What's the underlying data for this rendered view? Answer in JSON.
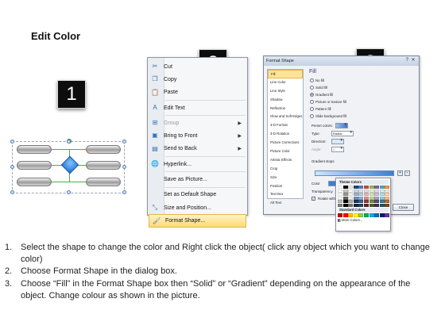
{
  "title": "Edit Color",
  "badges": [
    "1",
    "2",
    "3"
  ],
  "context_menu": {
    "items": [
      {
        "label": "Cut",
        "icon": "scissors-icon",
        "glyph": "✂",
        "disabled": false,
        "arrow": false
      },
      {
        "label": "Copy",
        "icon": "copy-icon",
        "glyph": "❐",
        "disabled": false,
        "arrow": false
      },
      {
        "label": "Paste",
        "icon": "paste-icon",
        "glyph": "📋",
        "disabled": false,
        "arrow": false
      },
      {
        "label": "Edit Text",
        "icon": "edit-text-icon",
        "glyph": "A",
        "disabled": false,
        "arrow": false,
        "sep_before": true
      },
      {
        "label": "Group",
        "icon": "group-icon",
        "glyph": "⊞",
        "disabled": true,
        "arrow": true,
        "sep_before": true
      },
      {
        "label": "Bring to Front",
        "icon": "bring-front-icon",
        "glyph": "▣",
        "disabled": false,
        "arrow": true
      },
      {
        "label": "Send to Back",
        "icon": "send-back-icon",
        "glyph": "▤",
        "disabled": false,
        "arrow": true
      },
      {
        "label": "Hyperlink...",
        "icon": "hyperlink-icon",
        "glyph": "🌐",
        "disabled": false,
        "arrow": false,
        "sep_before": true
      },
      {
        "label": "Save as Picture...",
        "icon": "",
        "glyph": "",
        "disabled": false,
        "arrow": false,
        "sep_before": true
      },
      {
        "label": "Set as Default Shape",
        "icon": "",
        "glyph": "",
        "disabled": false,
        "arrow": false,
        "sep_before": true
      },
      {
        "label": "Size and Position...",
        "icon": "size-position-icon",
        "glyph": "⤡",
        "disabled": false,
        "arrow": false
      },
      {
        "label": "Format Shape...",
        "icon": "format-shape-icon",
        "glyph": "🖌",
        "disabled": false,
        "arrow": false,
        "highlighted": true
      }
    ]
  },
  "dialog": {
    "title": "Format Shape",
    "help": "?",
    "close_glyph": "✕",
    "nav": [
      "Fill",
      "Line Color",
      "Line Style",
      "Shadow",
      "Reflection",
      "Glow and Soft Edges",
      "3-D Format",
      "3-D Rotation",
      "Picture Corrections",
      "Picture Color",
      "Artistic Effects",
      "Crop",
      "Size",
      "Position",
      "Text Box",
      "Alt Text"
    ],
    "selected_nav": "Fill",
    "heading": "Fill",
    "fill_options": [
      {
        "label": "No fill",
        "checked": false
      },
      {
        "label": "Solid fill",
        "checked": false
      },
      {
        "label": "Gradient fill",
        "checked": true
      },
      {
        "label": "Picture or texture fill",
        "checked": false
      },
      {
        "label": "Pattern fill",
        "checked": false
      },
      {
        "label": "Slide background fill",
        "checked": false
      }
    ],
    "preset_label": "Preset colors:",
    "type_label": "Type:",
    "type_value": "Radial",
    "direction_label": "Direction:",
    "angle_label": "Angle:",
    "angle_value": "0°",
    "stops_label": "Gradient stops",
    "color_label": "Color",
    "position_label": "Position:",
    "position_value": "0%",
    "transparency_label": "Transparency",
    "rotate_label": "Rotate with shape",
    "close_label": "Close"
  },
  "palette": {
    "theme_heading": "Theme Colors",
    "standard_heading": "Standard Colors",
    "more_label": "More Colors...",
    "theme_top": [
      "#ffffff",
      "#000000",
      "#eeece1",
      "#1f497d",
      "#4f81bd",
      "#c0504d",
      "#9bbb59",
      "#8064a2",
      "#4bacc6",
      "#f79646"
    ],
    "standard": [
      "#c00000",
      "#ff0000",
      "#ffc000",
      "#ffff00",
      "#92d050",
      "#00b050",
      "#00b0f0",
      "#0070c0",
      "#002060",
      "#7030a0"
    ]
  },
  "instructions": [
    {
      "num": "1.",
      "text": "Select the shape to change the color and Right click the object( click any object which you want to change color)"
    },
    {
      "num": "2.",
      "text": "Choose Format Shape in the dialog box."
    },
    {
      "num": "3.",
      "text": "Choose “Fill” in the Format Shape box then “Solid” or “Gradient” depending on the appearance of the object. Change colour as shown in the picture."
    }
  ]
}
